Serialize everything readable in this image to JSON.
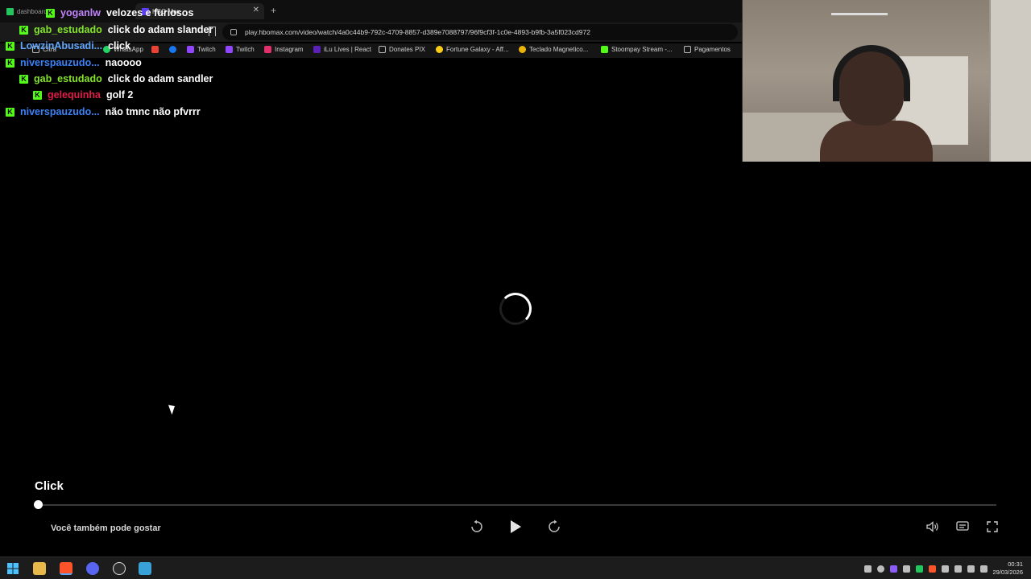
{
  "browser": {
    "tabs": [
      {
        "label": "dashboard"
      },
      {
        "label": "HBO Max"
      }
    ],
    "url": "play.hbomax.com/video/watch/4a0c44b9-792c-4709-8857-d389e7088797/96f9cf3f-1c0e-4893-b9fb-3a5f023cd972",
    "bookmarks": [
      {
        "label": "Citra",
        "color": "#cccccc"
      },
      {
        "label": "WhatsApp",
        "color": "#25d366"
      },
      {
        "label": "Twitch",
        "color": "#9146ff"
      },
      {
        "label": "Twitch",
        "color": "#9146ff"
      },
      {
        "label": "Instagram",
        "color": "#e1306c"
      },
      {
        "label": "iLu Lives | React",
        "color": "#5b21b6"
      },
      {
        "label": "Donates PIX",
        "color": "folder"
      },
      {
        "label": "Fortune Galaxy - Aff...",
        "color": "#facc15"
      },
      {
        "label": "Teclado Magnetico...",
        "color": "#eab308"
      },
      {
        "label": "Stoompay Stream -...",
        "color": "#53fc18"
      },
      {
        "label": "Pagamentos",
        "color": "folder"
      }
    ]
  },
  "chat": [
    {
      "user": "yoganlw",
      "message": "velozes e furiosos",
      "color": "#c084fc"
    },
    {
      "user": "gab_estudado",
      "message": "click do adam slander",
      "color": "#84e52d"
    },
    {
      "user": "LowzinAbusadi...",
      "message": "click",
      "color": "#60a5fa"
    },
    {
      "user": "niverspauzudo...",
      "message": "naoooo",
      "color": "#3b82f6"
    },
    {
      "user": "gab_estudado",
      "message": "click do adam sandler",
      "color": "#84e52d"
    },
    {
      "user": "gelequinha",
      "message": "golf 2",
      "color": "#e11d48"
    },
    {
      "user": "niverspauzudo...",
      "message": "não tmnc não pfvrrr",
      "color": "#3b82f6"
    }
  ],
  "player": {
    "title": "Click",
    "suggest_label": "Você também pode gostar",
    "progress": 0.0
  },
  "taskbar": {
    "time": "00:31",
    "date": "29/03/2026"
  },
  "colors": {
    "accent": "#53fc18",
    "player_bg": "#000000"
  }
}
